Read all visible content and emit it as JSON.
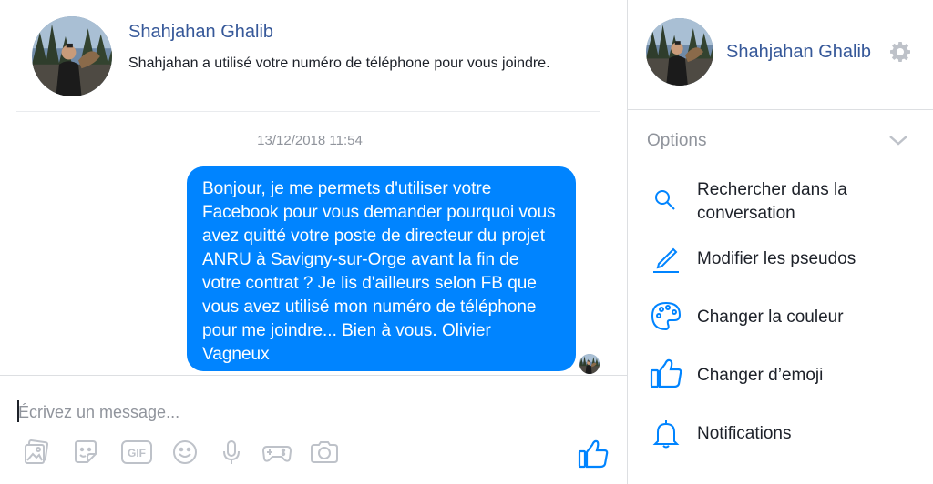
{
  "conversation": {
    "contact_name": "Shahjahan Ghalib",
    "contact_description": "Shahjahan a utilisé votre numéro de téléphone pour vous joindre.",
    "timestamp": "13/12/2018 11:54",
    "messages": [
      {
        "direction": "outgoing",
        "text": "Bonjour, je me permets d'utiliser votre Facebook pour vous demander pourquoi vous avez quitté votre poste de directeur du projet ANRU à Savigny-sur-Orge avant la fin de votre contrat ? Je lis d'ailleurs selon FB que vous avez utilisé mon numéro de téléphone pour me joindre... Bien à vous. Olivier Vagneux"
      }
    ]
  },
  "composer": {
    "placeholder": "Écrivez un message...",
    "toolbar_icons": [
      "photo-icon",
      "sticker-icon",
      "gif-icon",
      "emoji-icon",
      "microphone-icon",
      "game-icon",
      "camera-icon"
    ],
    "gif_label": "GIF",
    "send_icon": "thumbs-up-icon"
  },
  "sidebar": {
    "contact_name": "Shahjahan Ghalib",
    "options_label": "Options",
    "options": [
      {
        "icon": "search-icon",
        "label": "Rechercher dans la conversation"
      },
      {
        "icon": "pencil-icon",
        "label": "Modifier les pseudos"
      },
      {
        "icon": "palette-icon",
        "label": "Changer la couleur"
      },
      {
        "icon": "thumbs-up-icon",
        "label": "Changer d’emoji"
      },
      {
        "icon": "bell-icon",
        "label": "Notifications"
      }
    ]
  },
  "colors": {
    "accent": "#0084ff",
    "name_link": "#365899",
    "muted_text": "#90949c",
    "icon_gray": "#bec2c9"
  }
}
